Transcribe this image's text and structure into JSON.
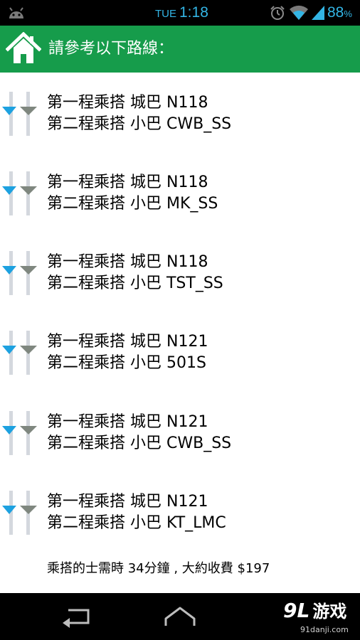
{
  "status_bar": {
    "day": "TUE",
    "time": "1:18",
    "battery_number": "88",
    "battery_percent_sign": "%",
    "accent_color": "#33b5e5",
    "icons": [
      "android-icon",
      "alarm-icon",
      "wifi-icon",
      "signal-icon"
    ]
  },
  "header": {
    "title": "請參考以下路線：",
    "background_color": "#169c4b",
    "icon": "home-icon"
  },
  "routes": [
    {
      "first_leg": "第一程乘搭 城巴 N118",
      "second_leg": "第二程乘搭 小巴 CWB_SS"
    },
    {
      "first_leg": "第一程乘搭 城巴 N118",
      "second_leg": "第二程乘搭 小巴 MK_SS"
    },
    {
      "first_leg": "第一程乘搭 城巴 N118",
      "second_leg": "第二程乘搭 小巴 TST_SS"
    },
    {
      "first_leg": "第一程乘搭 城巴 N121",
      "second_leg": "第二程乘搭 小巴 501S"
    },
    {
      "first_leg": "第一程乘搭 城巴 N121",
      "second_leg": "第二程乘搭 小巴 CWB_SS"
    },
    {
      "first_leg": "第一程乘搭 城巴 N121",
      "second_leg": "第二程乘搭 小巴 KT_LMC"
    }
  ],
  "taxi_info": "乘搭的士需時 34分鐘 , 大約收費 $197",
  "nav_bar": {
    "icons": [
      "back-icon",
      "home-icon"
    ],
    "watermark_number": "9L",
    "watermark_text": "游戏",
    "watermark_url": "91danji.com"
  }
}
